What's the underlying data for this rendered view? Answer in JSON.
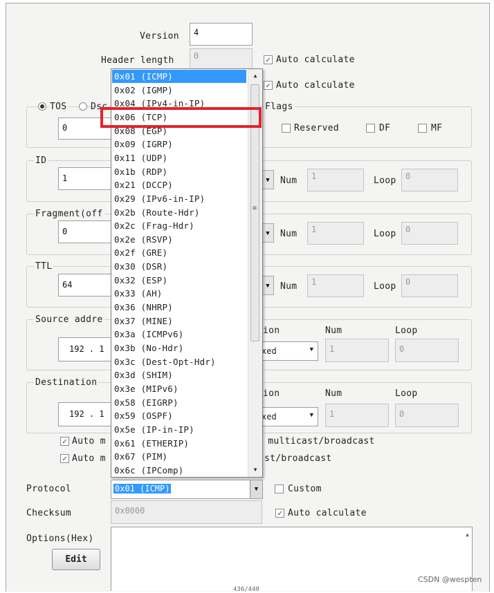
{
  "fields": {
    "version": {
      "label": "Version",
      "value": "4"
    },
    "header_length": {
      "label": "Header length",
      "value": "0",
      "auto_label": "Auto calculate"
    },
    "total_length": {
      "auto_label": "Auto calculate"
    },
    "tos": {
      "radio1": "TOS",
      "radio2": "Dsc",
      "value": "0"
    },
    "flags": {
      "title": "Flags",
      "reserved": "Reserved",
      "df": "DF",
      "mf": "MF"
    },
    "id": {
      "title": "ID",
      "value": "1",
      "num_label": "Num",
      "num_value": "1",
      "loop_label": "Loop",
      "loop_value": "0"
    },
    "fragment": {
      "title": "Fragment(off",
      "value": "0",
      "num_label": "Num",
      "num_value": "1",
      "loop_label": "Loop",
      "loop_value": "0"
    },
    "ttl": {
      "title": "TTL",
      "value": "64",
      "num_label": "Num",
      "num_value": "1",
      "loop_label": "Loop",
      "loop_value": "0"
    },
    "source": {
      "title": "Source addre",
      "ip": "192 . 1",
      "col_ion": "ion",
      "col_num": "Num",
      "col_loop": "Loop",
      "combo_value": "xed",
      "num_value": "1",
      "loop_value": "0"
    },
    "destination": {
      "title": "Destination",
      "ip": "192 . 1",
      "col_ion": "ion",
      "col_num": "Num",
      "col_loop": "Loop",
      "combo_value": "xed",
      "num_value": "1",
      "loop_value": "0"
    },
    "auto_row1": {
      "left": "Auto m",
      "right": "r multicast/broadcast"
    },
    "auto_row2": {
      "left": "Auto m",
      "right": "st/broadcast"
    },
    "protocol": {
      "label": "Protocol",
      "value": "0x01 (ICMP)",
      "custom": "Custom"
    },
    "checksum": {
      "label": "Checksum",
      "value": "0x0000",
      "auto_label": "Auto calculate"
    },
    "options": {
      "label": "Options(Hex)",
      "edit": "Edit"
    }
  },
  "protocol_options": [
    "0x01 (ICMP)",
    "0x02 (IGMP)",
    "0x04 (IPv4-in-IP)",
    "0x06 (TCP)",
    "0x08 (EGP)",
    "0x09 (IGRP)",
    "0x11 (UDP)",
    "0x1b (RDP)",
    "0x21 (DCCP)",
    "0x29 (IPv6-in-IP)",
    "0x2b (Route-Hdr)",
    "0x2c (Frag-Hdr)",
    "0x2e (RSVP)",
    "0x2f (GRE)",
    "0x30 (DSR)",
    "0x32 (ESP)",
    "0x33 (AH)",
    "0x36 (NHRP)",
    "0x37 (MINE)",
    "0x3a (ICMPv6)",
    "0x3b (No-Hdr)",
    "0x3c (Dest-Opt-Hdr)",
    "0x3d (SHIM)",
    "0x3e (MIPv6)",
    "0x58 (EIGRP)",
    "0x59 (OSPF)",
    "0x5e (IP-in-IP)",
    "0x61 (ETHERIP)",
    "0x67 (PIM)",
    "0x6c (IPComp)"
  ],
  "highlighted_option": "0x06 (TCP)",
  "watermark": "CSDN @wespten",
  "page_number": "436/440",
  "colors": {
    "selection": "#3399ff",
    "highlight_box": "#e0242c"
  }
}
